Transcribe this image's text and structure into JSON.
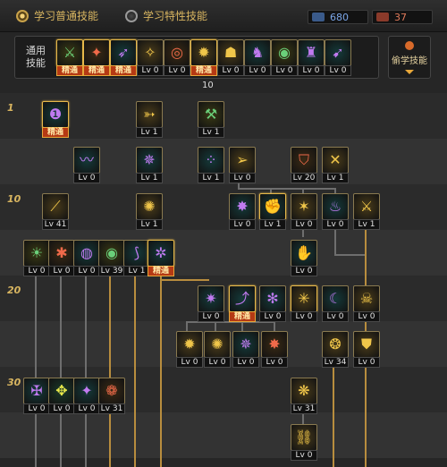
{
  "header": {
    "learn_normal": "学习普通技能",
    "learn_special": "学习特性技能",
    "points_blue": "680",
    "points_red": "37"
  },
  "common": {
    "label": "通用技能",
    "total": "10",
    "skills": [
      {
        "lv": "精通",
        "icon": "skill-run-icon",
        "glyph": "⚔"
      },
      {
        "lv": "精通",
        "icon": "skill-charge-icon",
        "glyph": "✦"
      },
      {
        "lv": "精通",
        "icon": "skill-leap-icon",
        "glyph": "➶"
      },
      {
        "lv": "Lv 0",
        "icon": "skill-wings-icon",
        "glyph": "✧"
      },
      {
        "lv": "Lv 0",
        "icon": "skill-target-icon",
        "glyph": "◎"
      },
      {
        "lv": "精通",
        "icon": "skill-burst-icon",
        "glyph": "✹"
      },
      {
        "lv": "Lv 0",
        "icon": "skill-guard-icon",
        "glyph": "☗"
      },
      {
        "lv": "Lv 0",
        "icon": "skill-kick-icon",
        "glyph": "♞"
      },
      {
        "lv": "Lv 0",
        "icon": "skill-orb-icon",
        "glyph": "◉"
      },
      {
        "lv": "Lv 0",
        "icon": "skill-flex-icon",
        "glyph": "♜"
      },
      {
        "lv": "Lv 0",
        "icon": "skill-dash-icon",
        "glyph": "➹"
      }
    ]
  },
  "steal": {
    "label": "偷学技能"
  },
  "rows": [
    "1",
    "10",
    "20",
    "30"
  ],
  "tree": [
    {
      "lv": "精通",
      "icon": "skill-book-icon",
      "glyph": "❶"
    },
    {
      "lv": "Lv 1",
      "icon": "skill-spear-icon",
      "glyph": "➳"
    },
    {
      "lv": "Lv 1",
      "icon": "skill-axe-icon",
      "glyph": "⚒"
    },
    {
      "lv": "Lv 0",
      "icon": "skill-whip-icon",
      "glyph": "〰"
    },
    {
      "lv": "Lv 1",
      "icon": "skill-rune-icon",
      "glyph": "✵"
    },
    {
      "lv": "Lv 1",
      "icon": "skill-dots-icon",
      "glyph": "⁘"
    },
    {
      "lv": "Lv 0",
      "icon": "skill-arrow-icon",
      "glyph": "➢"
    },
    {
      "lv": "Lv 20",
      "icon": "skill-shield-icon",
      "glyph": "⛉"
    },
    {
      "lv": "Lv 1",
      "icon": "skill-cross-icon",
      "glyph": "✕"
    },
    {
      "lv": "Lv 41",
      "icon": "skill-slash-icon",
      "glyph": "⟋"
    },
    {
      "lv": "Lv 1",
      "icon": "skill-swirl-icon",
      "glyph": "✺"
    },
    {
      "lv": "Lv 0",
      "icon": "skill-bomb-icon",
      "glyph": "✸"
    },
    {
      "lv": "Lv 1",
      "icon": "skill-fist-icon",
      "glyph": "✊"
    },
    {
      "lv": "Lv 0",
      "icon": "skill-flame-icon",
      "glyph": "✶"
    },
    {
      "lv": "Lv 0",
      "icon": "skill-fire-icon",
      "glyph": "♨"
    },
    {
      "lv": "Lv 1",
      "icon": "skill-sword-icon",
      "glyph": "⚔"
    },
    {
      "lv": "Lv 0",
      "icon": "skill-sun-icon",
      "glyph": "☀"
    },
    {
      "lv": "Lv 0",
      "icon": "skill-spiral-icon",
      "glyph": "✱"
    },
    {
      "lv": "Lv 0",
      "icon": "skill-ring-icon",
      "glyph": "◍"
    },
    {
      "lv": "Lv 39",
      "icon": "skill-eye-icon",
      "glyph": "◉"
    },
    {
      "lv": "Lv 1",
      "icon": "skill-wind-icon",
      "glyph": "⟆"
    },
    {
      "lv": "精通",
      "icon": "skill-gear-icon",
      "glyph": "✲"
    },
    {
      "lv": "Lv 0",
      "icon": "skill-palm-icon",
      "glyph": "✋"
    },
    {
      "lv": "Lv 0",
      "icon": "skill-star-icon",
      "glyph": "✷"
    },
    {
      "lv": "精通",
      "icon": "skill-jump-icon",
      "glyph": "⤴"
    },
    {
      "lv": "Lv 0",
      "icon": "skill-claw-icon",
      "glyph": "✻"
    },
    {
      "lv": "Lv 0",
      "icon": "skill-sigil-icon",
      "glyph": "✳"
    },
    {
      "lv": "Lv 0",
      "icon": "skill-moon-icon",
      "glyph": "☾"
    },
    {
      "lv": "Lv 0",
      "icon": "skill-demon-icon",
      "glyph": "☠"
    },
    {
      "lv": "Lv 0",
      "icon": "skill-blast-icon",
      "glyph": "✹"
    },
    {
      "lv": "Lv 0",
      "icon": "skill-spark-icon",
      "glyph": "✺"
    },
    {
      "lv": "Lv 0",
      "icon": "skill-nova-icon",
      "glyph": "✵"
    },
    {
      "lv": "Lv 0",
      "icon": "skill-burst2-icon",
      "glyph": "✸"
    },
    {
      "lv": "Lv 34",
      "icon": "skill-flare-icon",
      "glyph": "❂"
    },
    {
      "lv": "Lv 0",
      "icon": "skill-armor-icon",
      "glyph": "⛊"
    },
    {
      "lv": "Lv 0",
      "icon": "skill-rage-icon",
      "glyph": "✠"
    },
    {
      "lv": "Lv 0",
      "icon": "skill-inferno-icon",
      "glyph": "✥"
    },
    {
      "lv": "Lv 0",
      "icon": "skill-pyre-icon",
      "glyph": "✦"
    },
    {
      "lv": "Lv 31",
      "icon": "skill-vortex-icon",
      "glyph": "❁"
    },
    {
      "lv": "Lv 31",
      "icon": "skill-crest-icon",
      "glyph": "❋"
    },
    {
      "lv": "Lv 0",
      "icon": "skill-chain-icon",
      "glyph": "⛓"
    }
  ]
}
